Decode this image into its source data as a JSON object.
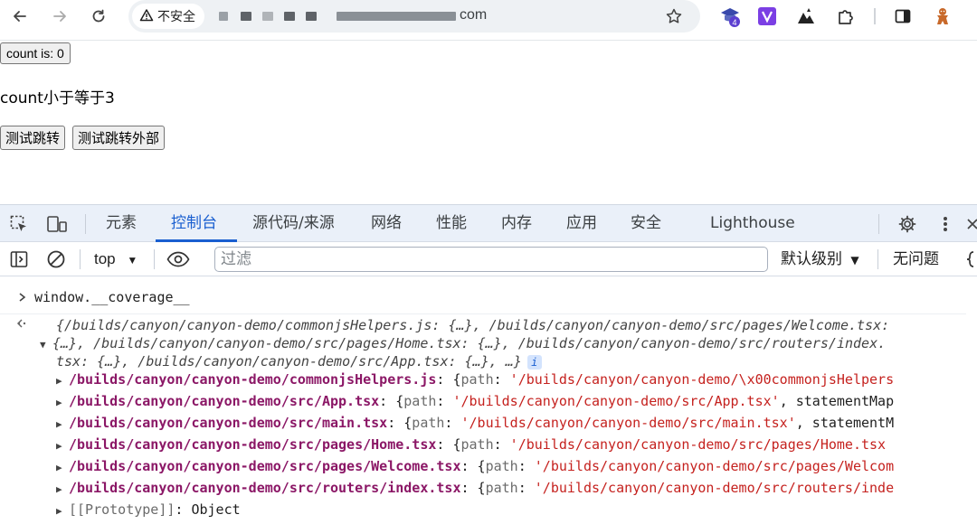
{
  "browser": {
    "security_label": "不安全",
    "url_suffix": "com"
  },
  "page": {
    "count_button": "count is: 0",
    "status_text": "count小于等于3",
    "jump_button": "测试跳转",
    "jump_external_button": "测试跳转外部"
  },
  "devtools": {
    "tabs": [
      "元素",
      "控制台",
      "源代码/来源",
      "网络",
      "性能",
      "内存",
      "应用",
      "安全",
      "Lighthouse"
    ],
    "active_tab": "控制台",
    "context": "top",
    "filter_placeholder": "过滤",
    "log_levels": "默认级别",
    "issues": "无问题",
    "console": {
      "input": "window.__coverage__",
      "summary_line1": "{/builds/canyon/canyon-demo/commonjsHelpers.js: {…}, /builds/canyon/canyon-demo/src/pages/Welcome.tsx:",
      "summary_line2": "{…}, /builds/canyon/canyon-demo/src/pages/Home.tsx: {…}, /builds/canyon/canyon-demo/src/routers/index.",
      "summary_line3": "tsx: {…}, /builds/canyon/canyon-demo/src/App.tsx: {…}, …}",
      "info_badge": "i",
      "entries": [
        {
          "key": "/builds/canyon/canyon-demo/commonjsHelpers.js",
          "path": "'/builds/canyon/canyon-demo/\\x00commonjsHelpers",
          "tail": ""
        },
        {
          "key": "/builds/canyon/canyon-demo/src/App.tsx",
          "path": "'/builds/canyon/canyon-demo/src/App.tsx'",
          "tail": ", statementMap"
        },
        {
          "key": "/builds/canyon/canyon-demo/src/main.tsx",
          "path": "'/builds/canyon/canyon-demo/src/main.tsx'",
          "tail": ", statementM"
        },
        {
          "key": "/builds/canyon/canyon-demo/src/pages/Home.tsx",
          "path": "'/builds/canyon/canyon-demo/src/pages/Home.tsx",
          "tail": ""
        },
        {
          "key": "/builds/canyon/canyon-demo/src/pages/Welcome.tsx",
          "path": "'/builds/canyon/canyon-demo/src/pages/Welcom",
          "tail": ""
        },
        {
          "key": "/builds/canyon/canyon-demo/src/routers/index.tsx",
          "path": "'/builds/canyon/canyon-demo/src/routers/inde",
          "tail": ""
        }
      ],
      "prototype_key": "[[Prototype]]",
      "prototype_value": "Object"
    }
  },
  "colors": {
    "accent": "#1a5fd0",
    "object_key": "#8b1766",
    "string": "#c5221f",
    "devtools_tabbar": "#eaf0f9"
  }
}
